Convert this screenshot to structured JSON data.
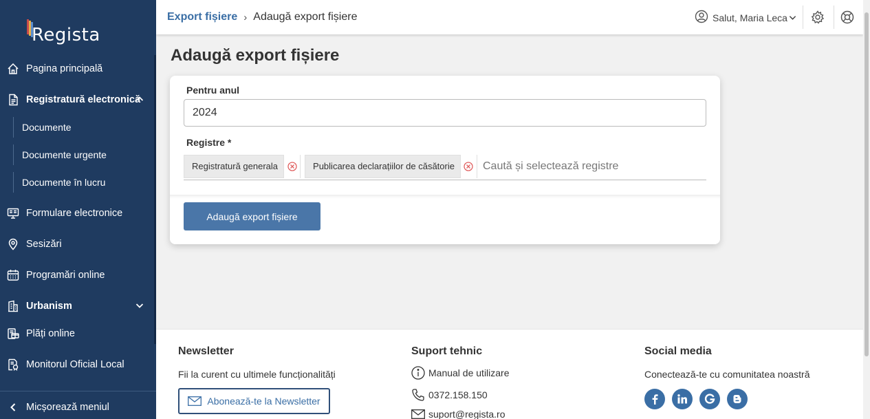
{
  "app": {
    "logo_text": "Regista"
  },
  "sidebar": {
    "items": [
      {
        "label": "Pagina principală",
        "icon": "home-icon"
      },
      {
        "label": "Registratură electronică",
        "icon": "document-icon",
        "expanded": true,
        "children": [
          "Documente",
          "Documente urgente",
          "Documente în lucru"
        ]
      },
      {
        "label": "Formulare electronice",
        "icon": "monitor-form-icon"
      },
      {
        "label": "Sesizări",
        "icon": "map-pin-icon"
      },
      {
        "label": "Programări online",
        "icon": "calendar-icon"
      },
      {
        "label": "Urbanism",
        "icon": "building-icon",
        "expanded": false
      },
      {
        "label": "Plăți online",
        "icon": "payment-icon"
      },
      {
        "label": "Monitorul Oficial Local",
        "icon": "official-doc-icon"
      }
    ],
    "collapse_label": "Micșorează meniul"
  },
  "header": {
    "breadcrumb_parent": "Export fișiere",
    "breadcrumb_separator": "›",
    "breadcrumb_current": "Adaugă export fișiere",
    "user_greeting": "Salut, Maria Leca"
  },
  "main": {
    "title": "Adaugă export fișiere",
    "form": {
      "year_label": "Pentru anul",
      "year_value": "2024",
      "registers_label": "Registre *",
      "registers_selected": [
        "Registratură generala",
        "Publicarea declarațiilor de căsătorie"
      ],
      "registers_placeholder": "Caută și selectează registre",
      "submit_label": "Adaugă export fișiere"
    }
  },
  "footer": {
    "newsletter": {
      "title": "Newsletter",
      "text": "Fii la curent cu ultimele funcționalități",
      "button_label": "Abonează-te la Newsletter"
    },
    "support": {
      "title": "Suport tehnic",
      "manual": "Manual de utilizare",
      "phone": "0372.158.150",
      "email": "suport@regista.ro"
    },
    "social": {
      "title": "Social media",
      "text": "Conectează-te cu comunitatea noastră",
      "links": [
        "facebook-icon",
        "linkedin-icon",
        "google-icon",
        "blogger-icon"
      ]
    }
  },
  "colors": {
    "sidebar_bg": "#1f3b60",
    "accent": "#3a6ea5",
    "button_bg": "#4a76a8",
    "page_bg": "#f1f1f1"
  }
}
